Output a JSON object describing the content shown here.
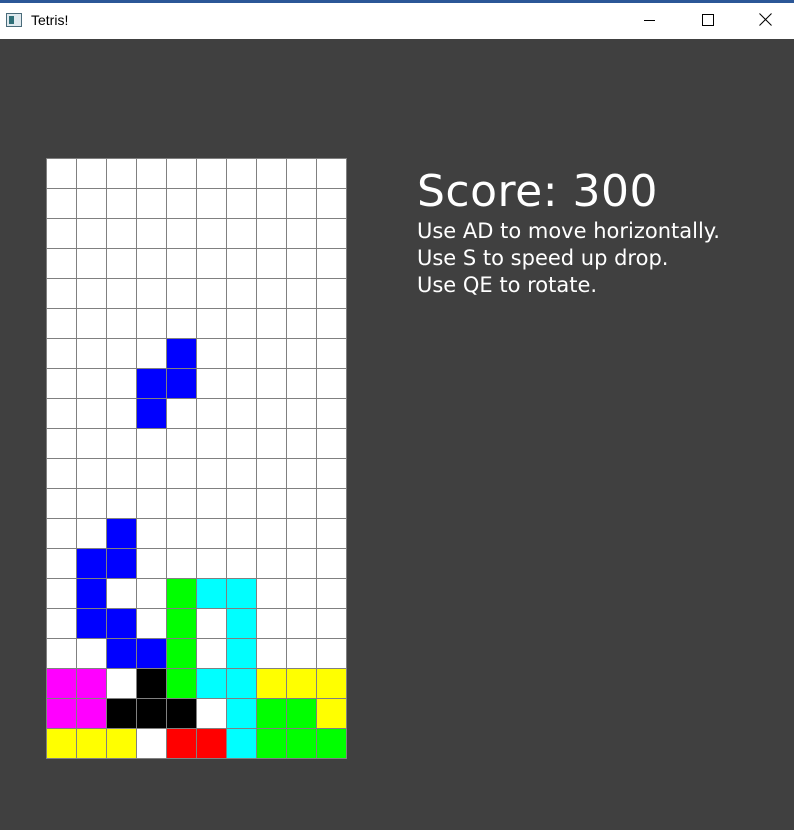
{
  "window": {
    "title": "Tetris!",
    "icon": "app-window-icon",
    "controls": [
      "minimize-icon",
      "maximize-icon",
      "close-icon"
    ]
  },
  "colors": {
    "background": "#404040",
    "grid_line": "#808080",
    "empty": "#ffffff",
    "B": "#0000ff",
    "G": "#00ff00",
    "C": "#00ffff",
    "M": "#ff00ff",
    "K": "#000000",
    "Y": "#ffff00",
    "R": "#ff0000"
  },
  "board": {
    "columns": 10,
    "rows": 20,
    "grid": [
      "..........",
      "..........",
      "..........",
      "..........",
      "..........",
      "..........",
      "....B.....",
      "...BB.....",
      "...B......",
      "..........",
      "..........",
      "..........",
      "..B.......",
      ".BB.......",
      ".B..GCC...",
      ".BB.G.C...",
      "..BBG.C...",
      "MM.KGCCYYY",
      "MMKKK.CGGY",
      "YYY.RRCGGG"
    ]
  },
  "score": {
    "text": "Score: 300",
    "value": 300
  },
  "instructions": [
    "Use AD to move horizontally.",
    "Use S to speed up drop.",
    "Use QE to rotate."
  ]
}
